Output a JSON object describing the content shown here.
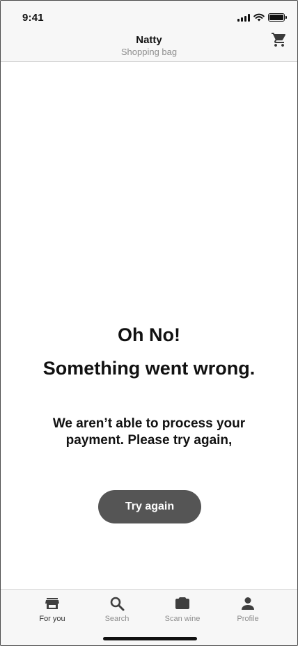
{
  "status_bar": {
    "time": "9:41"
  },
  "header": {
    "title": "Natty",
    "subtitle": "Shopping bag",
    "cart_icon": "shopping-cart-icon"
  },
  "error": {
    "title_line1": "Oh No!",
    "title_line2": "Something went wrong.",
    "message": "We aren’t able to process your payment. Please try again,",
    "button_label": "Try again"
  },
  "tabs": [
    {
      "label": "For you",
      "icon": "store-icon",
      "active": true
    },
    {
      "label": "Search",
      "icon": "search-icon",
      "active": false
    },
    {
      "label": "Scan wine",
      "icon": "camera-icon",
      "active": false
    },
    {
      "label": "Profile",
      "icon": "person-icon",
      "active": false
    }
  ],
  "colors": {
    "button_bg": "#555555",
    "header_bg": "#f7f7f7",
    "muted_text": "#8e8e8e"
  }
}
